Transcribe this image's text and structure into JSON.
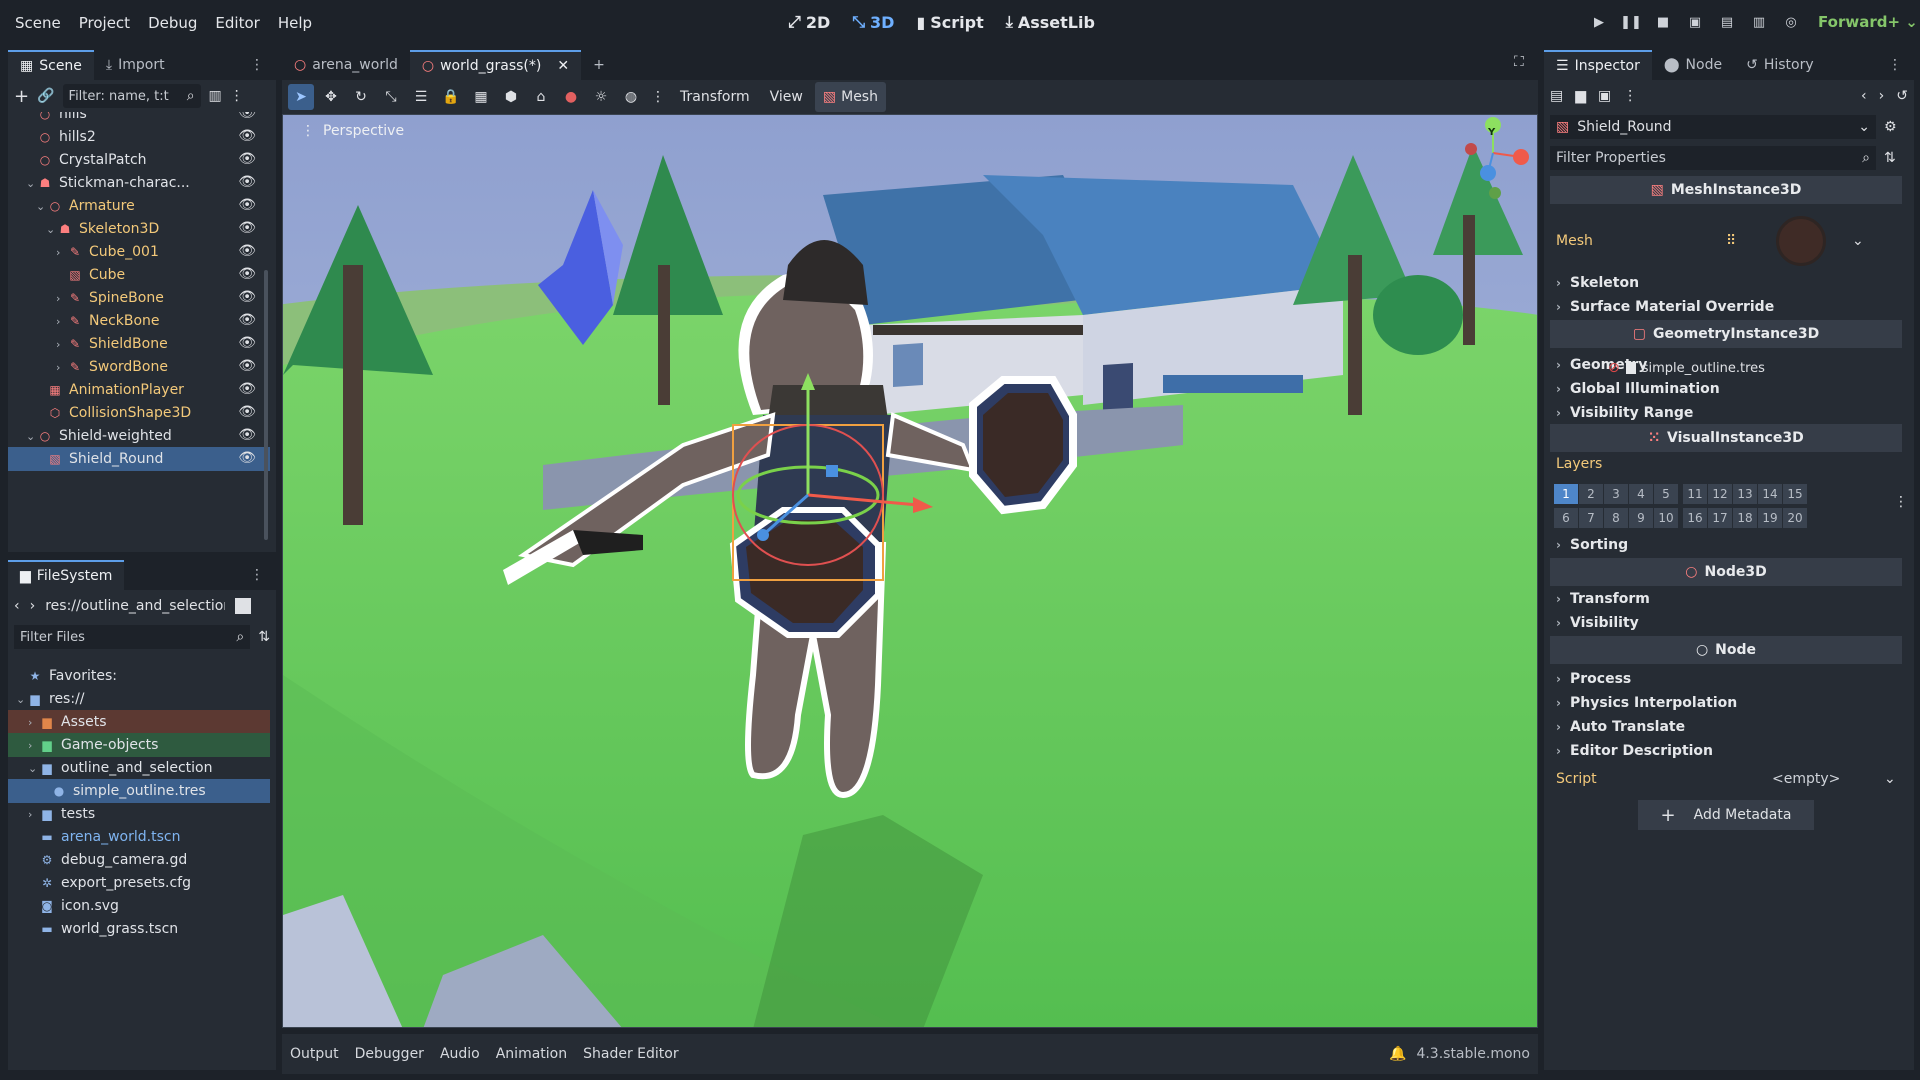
{
  "menu": [
    "Scene",
    "Project",
    "Debug",
    "Editor",
    "Help"
  ],
  "modes": [
    {
      "label": "2D",
      "icon": "2d-icon"
    },
    {
      "label": "3D",
      "icon": "3d-icon",
      "active": true
    },
    {
      "label": "Script",
      "icon": "script-icon"
    },
    {
      "label": "AssetLib",
      "icon": "assetlib-icon"
    }
  ],
  "renderer": "Forward+",
  "left_tabs": {
    "scene": "Scene",
    "import": "Import"
  },
  "scene_filter_placeholder": "Filter: name, t:t",
  "scene_tree": [
    {
      "label": "hills",
      "depth": 2,
      "icon": "node3d-icon",
      "color": "#e0e3e8"
    },
    {
      "label": "hills2",
      "depth": 2,
      "icon": "node3d-icon",
      "color": "#e0e3e8"
    },
    {
      "label": "CrystalPatch",
      "depth": 2,
      "icon": "node3d-icon",
      "color": "#e0e3e8"
    },
    {
      "label": "Stickman-charac...",
      "depth": 2,
      "icon": "skeleton-icon",
      "color": "#e0e3e8",
      "expanded": true
    },
    {
      "label": "Armature",
      "depth": 3,
      "icon": "node3d-icon",
      "color": "#f3c97a",
      "expanded": true
    },
    {
      "label": "Skeleton3D",
      "depth": 4,
      "icon": "skeleton-icon",
      "color": "#f3c97a",
      "expanded": true
    },
    {
      "label": "Cube_001",
      "depth": 5,
      "icon": "bone-mesh-icon",
      "color": "#f3c97a",
      "collapsed": true
    },
    {
      "label": "Cube",
      "depth": 5,
      "icon": "mesh-icon",
      "color": "#f3c97a"
    },
    {
      "label": "SpineBone",
      "depth": 5,
      "icon": "bone-mesh-icon",
      "color": "#f3c97a",
      "collapsed": true
    },
    {
      "label": "NeckBone",
      "depth": 5,
      "icon": "bone-mesh-icon",
      "color": "#f3c97a",
      "collapsed": true
    },
    {
      "label": "ShieldBone",
      "depth": 5,
      "icon": "bone-mesh-icon",
      "color": "#f3c97a",
      "collapsed": true
    },
    {
      "label": "SwordBone",
      "depth": 5,
      "icon": "bone-mesh-icon",
      "color": "#f3c97a",
      "collapsed": true
    },
    {
      "label": "AnimationPlayer",
      "depth": 3,
      "icon": "animation-player-icon",
      "color": "#f3c97a"
    },
    {
      "label": "CollisionShape3D",
      "depth": 3,
      "icon": "collision-icon",
      "color": "#f3c97a"
    },
    {
      "label": "Shield-weighted",
      "depth": 2,
      "icon": "node3d-icon",
      "color": "#e0e3e8",
      "expanded": true
    },
    {
      "label": "Shield_Round",
      "depth": 3,
      "icon": "mesh-icon",
      "color": "#e0e3e8",
      "selected": true
    }
  ],
  "filesystem": {
    "title": "FileSystem",
    "path": "res://outline_and_selection/",
    "filter_placeholder": "Filter Files",
    "items": [
      {
        "label": "Favorites:",
        "depth": 0,
        "icon": "star-icon"
      },
      {
        "label": "res://",
        "depth": 0,
        "icon": "folder-icon",
        "expanded": true
      },
      {
        "label": "Assets",
        "depth": 1,
        "icon": "folder-icon",
        "bg": "#5c3932",
        "folderColor": "#e0864a",
        "collapsed": true
      },
      {
        "label": "Game-objects",
        "depth": 1,
        "icon": "folder-icon",
        "bg": "#2e5a3f",
        "folderColor": "#62d08a",
        "collapsed": true
      },
      {
        "label": "outline_and_selection",
        "depth": 1,
        "icon": "folder-icon",
        "expanded": true
      },
      {
        "label": "simple_outline.tres",
        "depth": 2,
        "icon": "resource-icon",
        "selected": true
      },
      {
        "label": "tests",
        "depth": 1,
        "icon": "folder-icon",
        "collapsed": true
      },
      {
        "label": "arena_world.tscn",
        "depth": 1,
        "icon": "scene-file-icon",
        "color": "#7fb4f0"
      },
      {
        "label": "debug_camera.gd",
        "depth": 1,
        "icon": "gear-icon"
      },
      {
        "label": "export_presets.cfg",
        "depth": 1,
        "icon": "config-icon"
      },
      {
        "label": "icon.svg",
        "depth": 1,
        "icon": "image-icon"
      },
      {
        "label": "world_grass.tscn",
        "depth": 1,
        "icon": "scene-file-icon"
      }
    ]
  },
  "editor_tabs": [
    {
      "label": "arena_world"
    },
    {
      "label": "world_grass(*)",
      "active": true
    }
  ],
  "viewport_toolbar": {
    "transform": "Transform",
    "view": "View",
    "mesh": "Mesh"
  },
  "viewport_label": "Perspective",
  "gizmo": {
    "y": "Y"
  },
  "inspector": {
    "tabs": [
      "Inspector",
      "Node",
      "History"
    ],
    "node_name": "Shield_Round",
    "filter_placeholder": "Filter Properties",
    "sections": {
      "mesh_instance": "MeshInstance3D",
      "mesh_label": "Mesh",
      "skeleton": "Skeleton",
      "surface_override": "Surface Material Override",
      "geometry_instance": "GeometryInstance3D",
      "geometry": "Geometry",
      "drag_tooltip": "simple_outline.tres",
      "global_illumination": "Global Illumination",
      "visibility_range": "Visibility Range",
      "visual_instance": "VisualInstance3D",
      "layers_label": "Layers",
      "sorting": "Sorting",
      "node3d": "Node3D",
      "transform": "Transform",
      "visibility": "Visibility",
      "node": "Node",
      "process": "Process",
      "physics_interp": "Physics Interpolation",
      "auto_translate": "Auto Translate",
      "editor_description": "Editor Description",
      "script_label": "Script",
      "script_value": "<empty>",
      "add_metadata": "Add Metadata"
    },
    "layers_row1": [
      "1",
      "2",
      "3",
      "4",
      "5",
      "11",
      "12",
      "13",
      "14",
      "15"
    ],
    "layers_row2": [
      "6",
      "7",
      "8",
      "9",
      "10",
      "16",
      "17",
      "18",
      "19",
      "20"
    ]
  },
  "bottom_tabs": [
    "Output",
    "Debugger",
    "Audio",
    "Animation",
    "Shader Editor"
  ],
  "version": "4.3.stable.mono",
  "colors": {
    "accent": "#5d9ee8",
    "selected": "#3b5f8c",
    "node_red": "#fc7f7f",
    "scene_orange": "#f3c97a"
  }
}
